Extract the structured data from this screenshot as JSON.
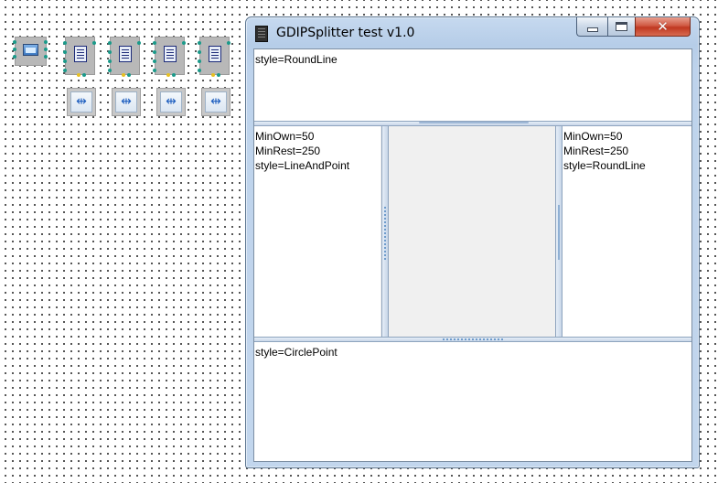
{
  "canvas_components": {
    "form_icon": "form-component-icon",
    "memo_icon": "memo-component-icon",
    "splitter_icon": "splitter-component-icon",
    "splitter_glyph": "⇹"
  },
  "window": {
    "title": "GDIPSplitter test v1.0",
    "controls": {
      "minimize_icon": "minimize-icon",
      "maximize_icon": "maximize-icon",
      "close_glyph": "✕"
    },
    "panels": {
      "top": {
        "text": "style=RoundLine"
      },
      "left": {
        "text": "MinOwn=50\nMinRest=250\nstyle=LineAndPoint"
      },
      "right": {
        "text": "MinOwn=50\nMinRest=250\nstyle=RoundLine"
      },
      "bottom": {
        "text": "style=CirclePoint"
      }
    }
  },
  "colors": {
    "titlebar": "#bed3ec",
    "close_button": "#c03820",
    "splitter": "#c8d6e8",
    "client_bg": "#f0f0f0"
  }
}
